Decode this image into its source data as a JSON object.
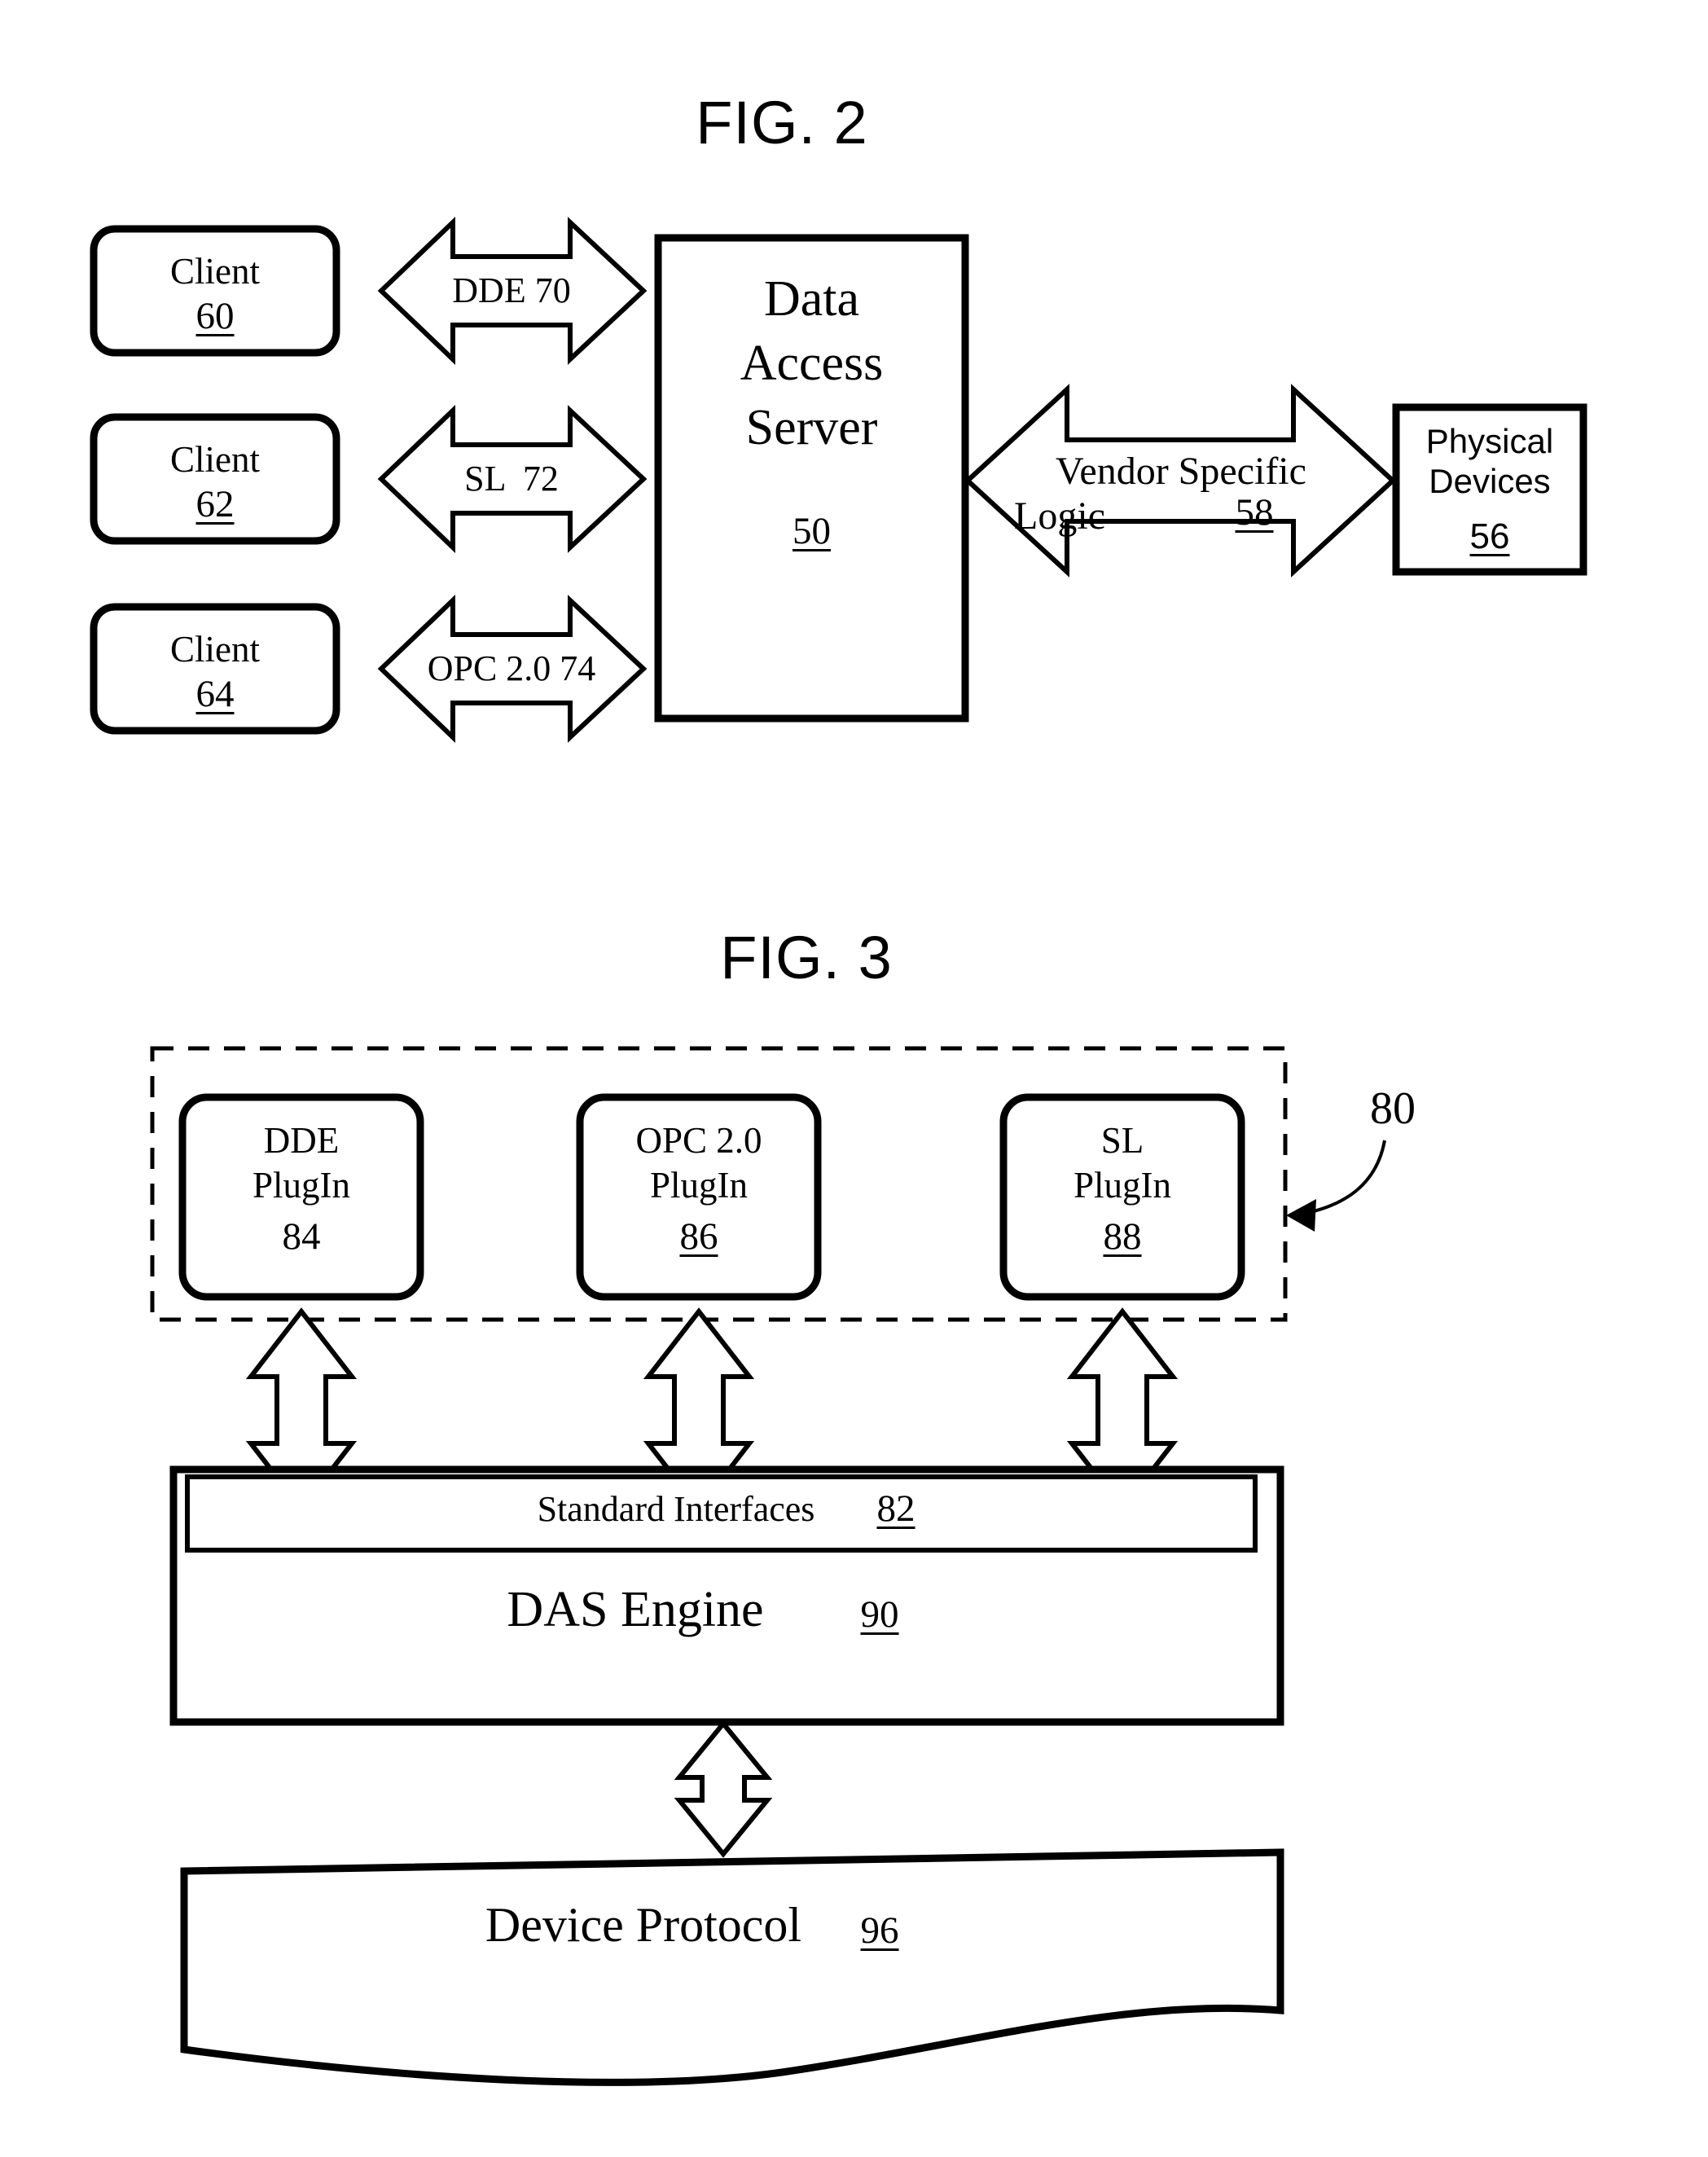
{
  "figures": [
    {
      "id": "fig2",
      "title": "FIG. 2",
      "clients": [
        {
          "name": "Client",
          "ref": "60"
        },
        {
          "name": "Client",
          "ref": "62"
        },
        {
          "name": "Client",
          "ref": "64"
        }
      ],
      "connectors": [
        {
          "label": "DDE",
          "ref": "70",
          "text": "DDE 70"
        },
        {
          "label": "SL",
          "ref": "72",
          "text": "SL  72"
        },
        {
          "label": "OPC 2.0",
          "ref": "74",
          "text": "OPC 2.0 74"
        }
      ],
      "server": {
        "line1": "Data",
        "line2": "Access",
        "line3": "Server",
        "ref": "50"
      },
      "vendor_link": {
        "line1": "Vendor Specific",
        "line2": "Logic",
        "ref": "58"
      },
      "devices": {
        "line1": "Physical",
        "line2": "Devices",
        "ref": "56"
      }
    },
    {
      "id": "fig3",
      "title": "FIG. 3",
      "container_ref": "80",
      "plugins": [
        {
          "line1": "DDE",
          "line2": "PlugIn",
          "ref": "84"
        },
        {
          "line1": "OPC 2.0",
          "line2": "PlugIn",
          "ref": "86"
        },
        {
          "line1": "SL",
          "line2": "PlugIn",
          "ref": "88"
        }
      ],
      "standard_interfaces": {
        "label": "Standard Interfaces",
        "ref": "82"
      },
      "das_engine": {
        "label": "DAS Engine",
        "ref": "90"
      },
      "device_protocol": {
        "label": "Device Protocol",
        "ref": "96"
      }
    }
  ],
  "colors": {
    "ink": "#000000",
    "paper": "#ffffff"
  }
}
